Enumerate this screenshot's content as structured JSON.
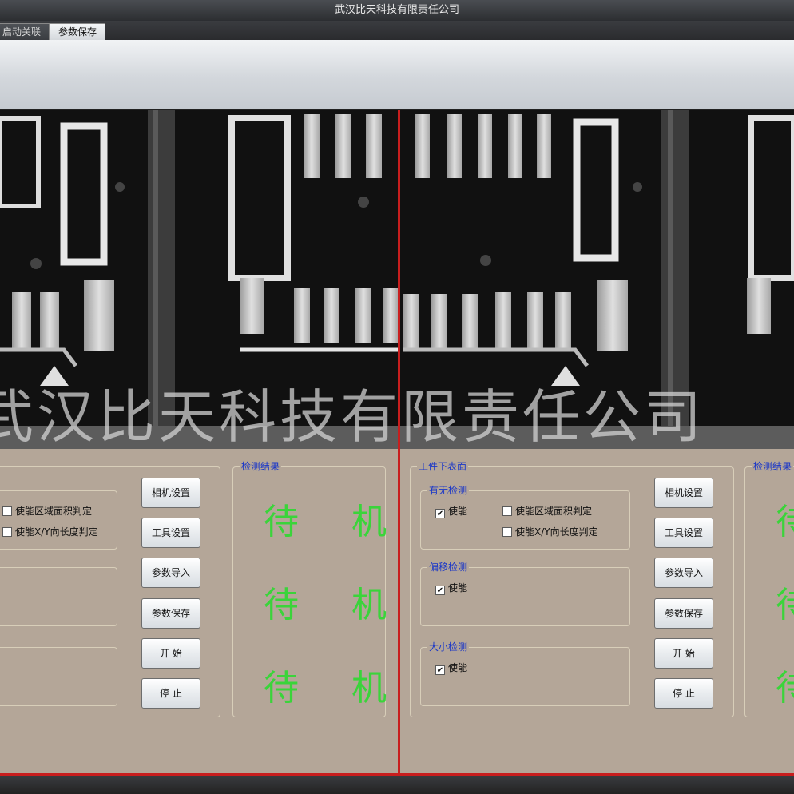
{
  "window": {
    "title": "武汉比天科技有限责任公司"
  },
  "tabs": [
    {
      "label": "启动关联"
    },
    {
      "label": "参数保存"
    }
  ],
  "watermark": "武汉比天科技有限责任公司",
  "left_panel": {
    "checkboxes": [
      {
        "label": "使能区域面积判定",
        "checked": false
      },
      {
        "label": "使能X/Y向长度判定",
        "checked": false
      }
    ],
    "buttons": [
      "相机设置",
      "工具设置",
      "参数导入",
      "参数保存",
      "开 始",
      "停 止"
    ],
    "result_title": "检测结果",
    "results": [
      "待 机",
      "待 机",
      "待 机"
    ]
  },
  "right_panel": {
    "title": "工件下表面",
    "group1": {
      "title": "有无检测",
      "enable": {
        "label": "使能",
        "checked": true
      },
      "options": [
        {
          "label": "使能区域面积判定",
          "checked": false
        },
        {
          "label": "使能X/Y向长度判定",
          "checked": false
        }
      ]
    },
    "group2": {
      "title": "偏移检测",
      "enable": {
        "label": "使能",
        "checked": true
      }
    },
    "group3": {
      "title": "大小检测",
      "enable": {
        "label": "使能",
        "checked": true
      }
    },
    "buttons": [
      "相机设置",
      "工具设置",
      "参数导入",
      "参数保存",
      "开 始",
      "停 止"
    ],
    "result_title": "检测结果",
    "results": [
      "待",
      "待",
      "待"
    ]
  },
  "colors": {
    "status_text": "#3ad43a",
    "group_title": "#1a37c8",
    "divider": "#c81e1e",
    "panel_bg": "#b4a698"
  }
}
